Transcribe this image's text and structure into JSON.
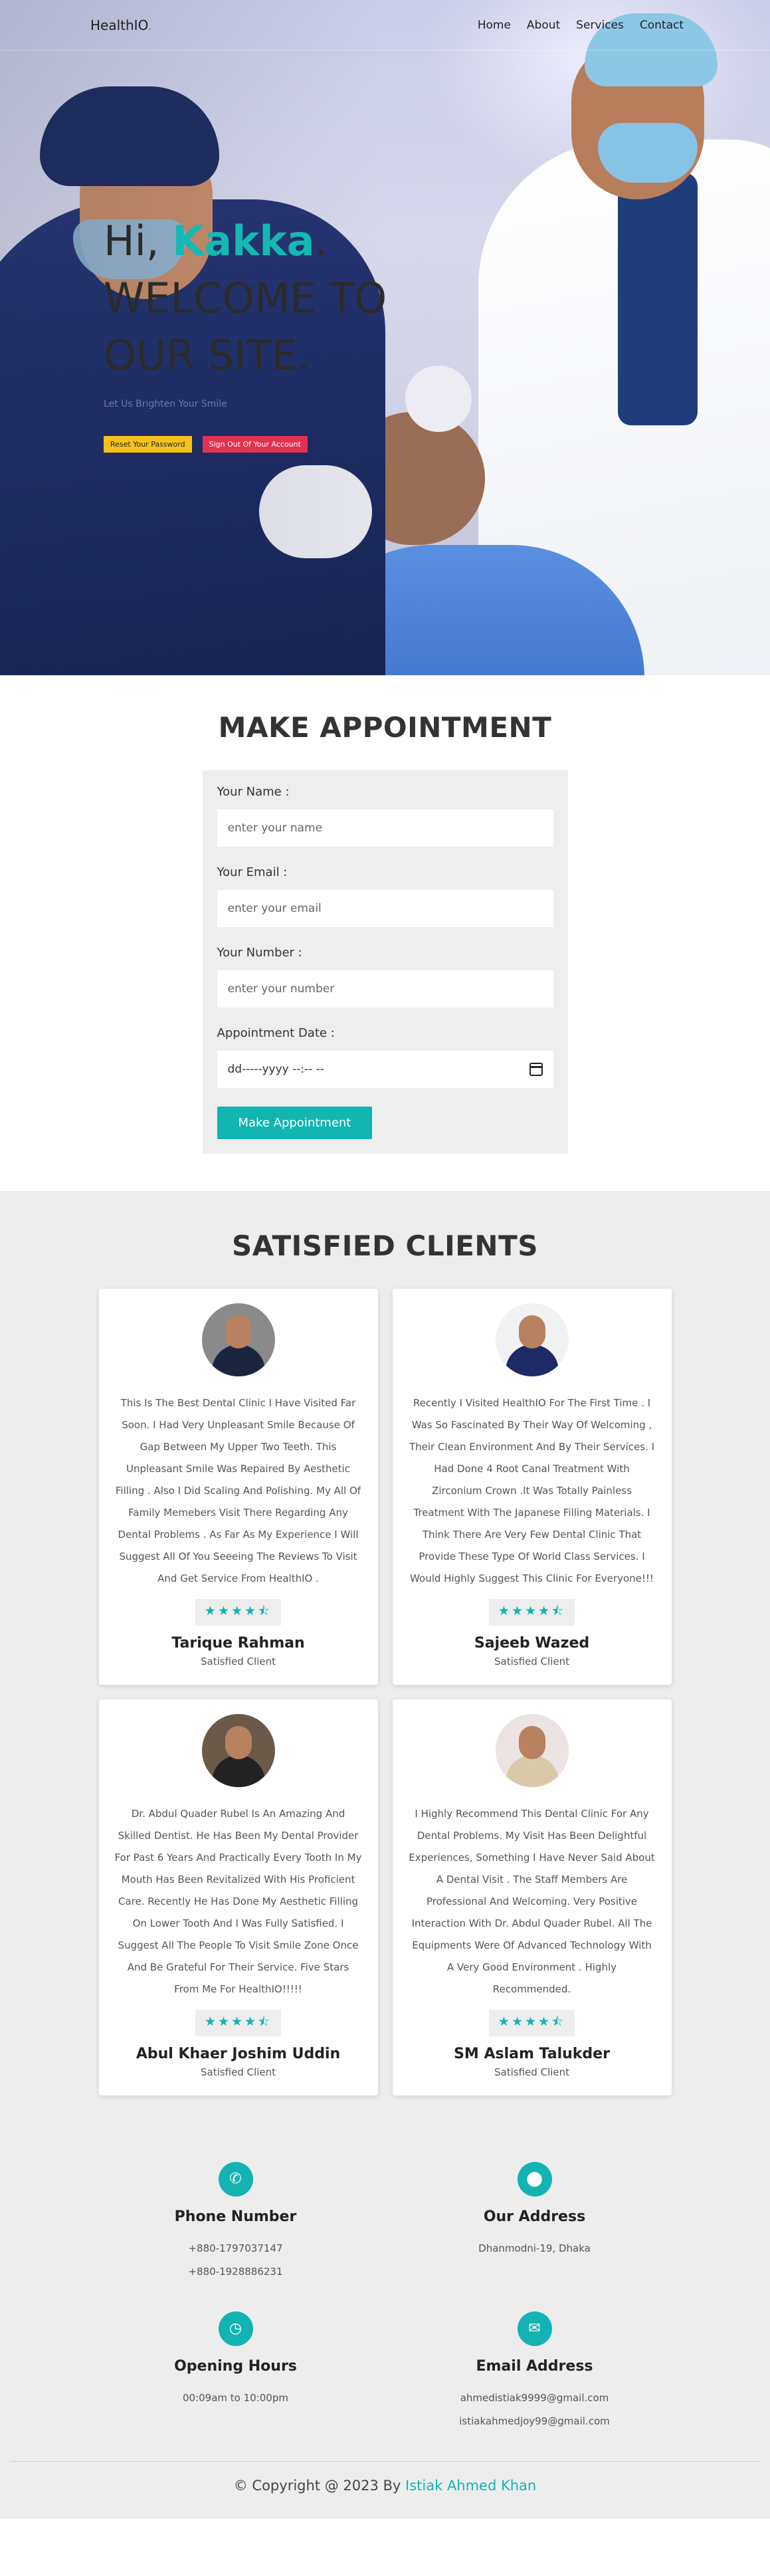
{
  "nav": {
    "brand": "HealthIO",
    "brand_dot": ".",
    "links": [
      "Home",
      "About",
      "Services",
      "Contact"
    ]
  },
  "hero": {
    "greeting": "Hi, ",
    "name": "Kakka",
    "greeting_end": ".",
    "line2": "WELCOME TO",
    "line3": "OUR SITE.",
    "subtitle": "Let Us Brighten Your Smile",
    "reset_button": "Reset Your Password",
    "signout_button": "Sign Out Of Your Account"
  },
  "appointment": {
    "title": "MAKE APPOINTMENT",
    "name_label": "Your Name :",
    "name_placeholder": "enter your name",
    "email_label": "Your Email :",
    "email_placeholder": "enter your email",
    "number_label": "Your Number :",
    "number_placeholder": "enter your number",
    "date_label": "Appointment Date :",
    "date_value": "dd-----yyyy --:-- --",
    "submit": "Make Appointment"
  },
  "clients": {
    "title": "SATISFIED CLIENTS",
    "stars": "★★★★⯪",
    "items": [
      {
        "review": "This Is The Best Dental Clinic I Have Visited Far Soon. I Had Very Unpleasant Smile Because Of Gap Between My Upper Two Teeth. This Unpleasant Smile Was Repaired By Aesthetic Filling . Also I Did Scaling And Polishing. My All Of Family Memebers Visit There Regarding Any Dental Problems . As Far As My Experience I Will Suggest All Of You Seeeing The Reviews To Visit And Get Service From HealthIO .",
        "name": "Tarique Rahman",
        "role": "Satisfied Client"
      },
      {
        "review": "Recently I Visited HealthIO For The First Time . I Was So Fascinated By Their Way Of Welcoming , Their Clean Environment And By Their Services. I Had Done 4 Root Canal Treatment With Zirconium Crown .It Was Totally Painless Treatment With The Japanese Filling Materials. I Think There Are Very Few Dental Clinic That Provide These Type Of World Class Services. I Would Highly Suggest This Clinic For Everyone!!!",
        "name": "Sajeeb Wazed",
        "role": "Satisfied Client"
      },
      {
        "review": "Dr. Abdul Quader Rubel Is An Amazing And Skilled Dentist. He Has Been My Dental Provider For Past 6 Years And Practically Every Tooth In My Mouth Has Been Revitalized With His Proficient Care. Recently He Has Done My Aesthetic Filling On Lower Tooth And I Was Fully Satisfied. I Suggest All The People To Visit Smile Zone Once And Be Grateful For Their Service. Five Stars From Me For HealthIO!!!!!",
        "name": "Abul Khaer Joshim Uddin",
        "role": "Satisfied Client"
      },
      {
        "review": "I Highly Recommend This Dental Clinic For Any Dental Problems. My Visit Has Been Delightful Experiences, Something I Have Never Said About A Dental Visit . The Staff Members Are Professional And Welcoming. Very Positive Interaction With Dr. Abdul Quader Rubel. All The Equipments Were Of Advanced Technology With A Very Good Environment . Highly Recommended.",
        "name": "SM Aslam Talukder",
        "role": "Satisfied Client"
      }
    ]
  },
  "contact": {
    "phone_title": "Phone Number",
    "phone_1": "+880-1797037147",
    "phone_2": "+880-1928886231",
    "address_title": "Our Address",
    "address": "Dhanmodni-19, Dhaka",
    "hours_title": "Opening Hours",
    "hours": "00:09am to 10:00pm",
    "email_title": "Email Address",
    "email_1": "ahmedistiak9999@gmail.com",
    "email_2": "istiakahmedjoy99@gmail.com"
  },
  "footer": {
    "copyright": "© Copyright @ 2023 By ",
    "author": "Istiak Ahmed Khan"
  },
  "colors": {
    "accent": "#14b3b3",
    "reset_button": "#f6c21a",
    "signout_button": "#e3324e"
  },
  "icons": [
    "phone-icon",
    "location-pin-icon",
    "clock-icon",
    "envelope-icon",
    "calendar-icon",
    "star-icon"
  ]
}
